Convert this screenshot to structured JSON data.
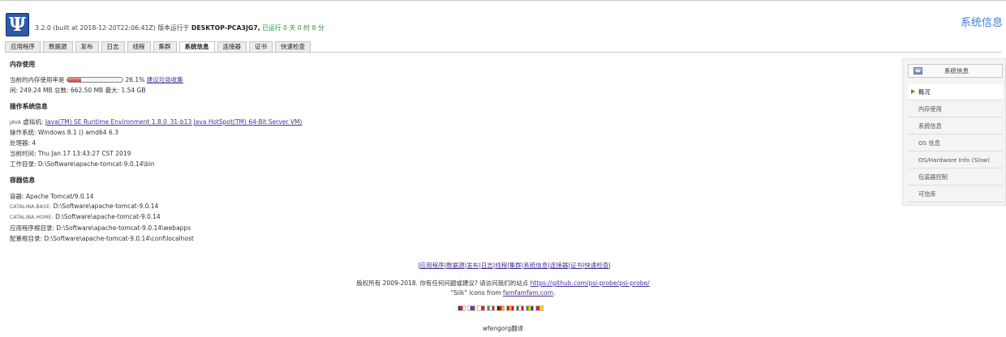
{
  "header": {
    "logo_glyph": "Ψ",
    "version_prefix": "3.2.0 (built at 2018-12-20T22:06:41Z) 版本运行于",
    "host": "DESKTOP-PCA3JG7,",
    "uptime": "已运行 0 天 0 时 8 分",
    "app_title": "系统信息"
  },
  "tabs": [
    {
      "label": "应用程序"
    },
    {
      "label": "数据源"
    },
    {
      "label": "发布"
    },
    {
      "label": "日志"
    },
    {
      "label": "线程"
    },
    {
      "label": "集群"
    },
    {
      "label": "系统信息",
      "active": true
    },
    {
      "label": "连接器"
    },
    {
      "label": "证书"
    },
    {
      "label": "快速检查"
    }
  ],
  "memory": {
    "title": "内存使用",
    "usage_label": "当前的内存使用率是",
    "usage_fraction": 0.261,
    "usage_percent": "26.1%",
    "gc_link": "建议垃圾收集",
    "stats": "闲: 249.24 MB 总数: 662.50 MB 最大: 1.54 GB"
  },
  "os": {
    "title": "操作系统信息",
    "jvm_label_sc": "JAVA",
    "jvm_label": "虚拟机:",
    "jvm_value": "Java(TM) SE Runtime Environment 1.8.0_31-b13 Java HotSpot(TM) 64-Bit Server VM)",
    "os_line": "操作系统: Windows 8.1 () amd64 6.3",
    "cpu_line": "处理器: 4",
    "time_line": "当前时间: Thu Jan 17 13:43:27 CST 2019",
    "workdir_line": "工作目录: D:\\Software\\apache-tomcat-9.0.14\\bin"
  },
  "container": {
    "title": "容器信息",
    "container_line": "容器: Apache Tomcat/9.0.14",
    "base_label": "CATALINA.BASE:",
    "base_value": "D:\\Software\\apache-tomcat-9.0.14",
    "home_label": "CATALINA.HOME:",
    "home_value": "D:\\Software\\apache-tomcat-9.0.14",
    "approot_line": "应用程序根目录: D:\\Software\\apache-tomcat-9.0.14\\webapps",
    "configroot_line": "配置根目录: D:\\Software\\apache-tomcat-9.0.14\\conf\\localhost"
  },
  "sidebar": {
    "header": "系统信息",
    "items": [
      {
        "label": "概况",
        "current": true
      },
      {
        "label": "内存使用"
      },
      {
        "label": "系统信息"
      },
      {
        "label": "OS 信息"
      },
      {
        "label": "OS/Hardware Info (Slow)"
      },
      {
        "label": "包装器控制"
      },
      {
        "label": "可信库"
      }
    ]
  },
  "footer": {
    "nav": [
      "应用程序",
      "数据源",
      "发布",
      "日志",
      "线程",
      "集群",
      "系统信息",
      "连接器",
      "证书",
      "快速检查"
    ],
    "copyright_prefix": "版权所有 2009-2018. 你有任何问题或建议? 请访问我们的站点",
    "copyright_link": "https://github.com/psi-probe/psi-probe/",
    "silk_prefix": "\"Silk\" icons from",
    "silk_link": "famfamfam.com",
    "silk_suffix": ".",
    "flags": [
      {
        "name": "uk-flag-icon",
        "colors": [
          "#2a3d8f",
          "#d8242a",
          "#ffffff"
        ]
      },
      {
        "name": "russia-flag-icon",
        "colors": [
          "#ffffff",
          "#2a52be",
          "#d8242a"
        ]
      },
      {
        "name": "japan-flag-icon",
        "colors": [
          "#ffffff",
          "#d8242a"
        ]
      },
      {
        "name": "italy-flag-icon",
        "colors": [
          "#2f9a3a",
          "#ffffff",
          "#d8242a"
        ]
      },
      {
        "name": "germany-flag-icon",
        "colors": [
          "#222222",
          "#d8242a",
          "#f5c400"
        ]
      },
      {
        "name": "spain-flag-icon",
        "colors": [
          "#c8102e",
          "#f5c400",
          "#c8102e"
        ]
      },
      {
        "name": "mexico-flag-icon",
        "colors": [
          "#2f7a3a",
          "#ffffff",
          "#c8102e"
        ]
      },
      {
        "name": "brazil-flag-icon",
        "colors": [
          "#2f9a3a",
          "#f5d400",
          "#2a3d8f"
        ]
      },
      {
        "name": "china-flag-icon",
        "colors": [
          "#d8242a",
          "#f5d400"
        ]
      }
    ],
    "credit": "wfengorg翻译"
  }
}
